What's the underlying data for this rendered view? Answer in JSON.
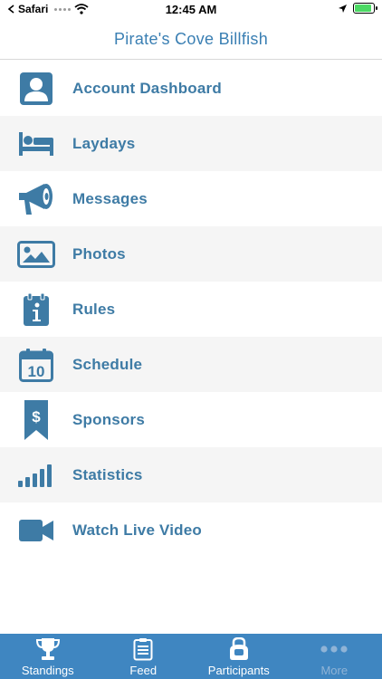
{
  "status_bar": {
    "carrier": "Safari",
    "time": "12:45 AM",
    "battery_level": 0.9
  },
  "header": {
    "title": "Pirate's Cove Billfish"
  },
  "colors": {
    "accent": "#3e7ba5",
    "title": "#3a7fb3",
    "tab_bar": "#3f86c1",
    "stripe": "#f5f5f5"
  },
  "menu": {
    "items": [
      {
        "label": "Account Dashboard",
        "icon": "user-icon"
      },
      {
        "label": "Laydays",
        "icon": "bed-icon"
      },
      {
        "label": "Messages",
        "icon": "megaphone-icon"
      },
      {
        "label": "Photos",
        "icon": "photo-icon"
      },
      {
        "label": "Rules",
        "icon": "info-clipboard-icon"
      },
      {
        "label": "Schedule",
        "icon": "calendar-icon"
      },
      {
        "label": "Sponsors",
        "icon": "dollar-ribbon-icon"
      },
      {
        "label": "Statistics",
        "icon": "bar-chart-icon"
      },
      {
        "label": "Watch Live Video",
        "icon": "video-camera-icon"
      }
    ]
  },
  "calendar_day": "10",
  "tabs": [
    {
      "label": "Standings",
      "icon": "trophy-icon",
      "active": true
    },
    {
      "label": "Feed",
      "icon": "clipboard-icon",
      "active": true
    },
    {
      "label": "Participants",
      "icon": "kettlebell-icon",
      "active": true
    },
    {
      "label": "More",
      "icon": "more-dots-icon",
      "active": false
    }
  ]
}
